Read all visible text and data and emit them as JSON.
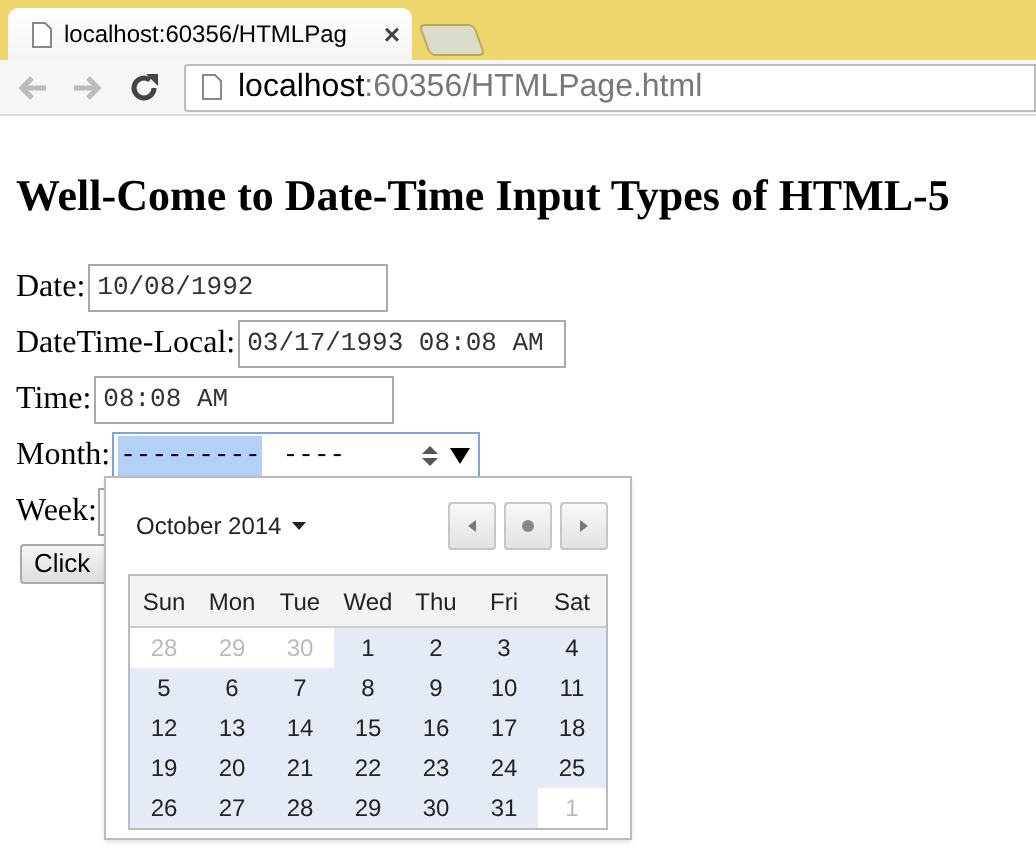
{
  "browser": {
    "tab": {
      "title": "localhost:60356/HTMLPag",
      "close": "×"
    },
    "address": {
      "host": "localhost",
      "path": ":60356/HTMLPage.html"
    }
  },
  "heading": "Well-Come to Date-Time Input Types of HTML-5",
  "fields": [
    {
      "label": "Date:",
      "value": "10/08/1992",
      "kind": "text"
    },
    {
      "label": "DateTime-Local:",
      "value": "03/17/1993 08:08 AM",
      "kind": "text"
    },
    {
      "label": "Time:",
      "value": "08:08 AM",
      "kind": "text"
    },
    {
      "label": "Month:",
      "month": "---------",
      "year": "----",
      "kind": "month"
    },
    {
      "label": "Week:",
      "kind": "hidden"
    }
  ],
  "button": "Click",
  "calendar": {
    "title": "October 2014",
    "weekdays": [
      "Sun",
      "Mon",
      "Tue",
      "Wed",
      "Thu",
      "Fri",
      "Sat"
    ],
    "weeks": [
      [
        {
          "day": "28",
          "muted": true
        },
        {
          "day": "29",
          "muted": true
        },
        {
          "day": "30",
          "muted": true
        },
        {
          "day": "1",
          "muted": false
        },
        {
          "day": "2",
          "muted": false
        },
        {
          "day": "3",
          "muted": false
        },
        {
          "day": "4",
          "muted": false
        }
      ],
      [
        {
          "day": "5",
          "muted": false
        },
        {
          "day": "6",
          "muted": false
        },
        {
          "day": "7",
          "muted": false
        },
        {
          "day": "8",
          "muted": false
        },
        {
          "day": "9",
          "muted": false
        },
        {
          "day": "10",
          "muted": false
        },
        {
          "day": "11",
          "muted": false
        }
      ],
      [
        {
          "day": "12",
          "muted": false
        },
        {
          "day": "13",
          "muted": false
        },
        {
          "day": "14",
          "muted": false
        },
        {
          "day": "15",
          "muted": false
        },
        {
          "day": "16",
          "muted": false
        },
        {
          "day": "17",
          "muted": false
        },
        {
          "day": "18",
          "muted": false
        }
      ],
      [
        {
          "day": "19",
          "muted": false
        },
        {
          "day": "20",
          "muted": false
        },
        {
          "day": "21",
          "muted": false
        },
        {
          "day": "22",
          "muted": false
        },
        {
          "day": "23",
          "muted": false
        },
        {
          "day": "24",
          "muted": false
        },
        {
          "day": "25",
          "muted": false
        }
      ],
      [
        {
          "day": "26",
          "muted": false
        },
        {
          "day": "27",
          "muted": false
        },
        {
          "day": "28",
          "muted": false
        },
        {
          "day": "29",
          "muted": false
        },
        {
          "day": "30",
          "muted": false
        },
        {
          "day": "31",
          "muted": false
        },
        {
          "day": "1",
          "muted": true
        }
      ]
    ]
  }
}
